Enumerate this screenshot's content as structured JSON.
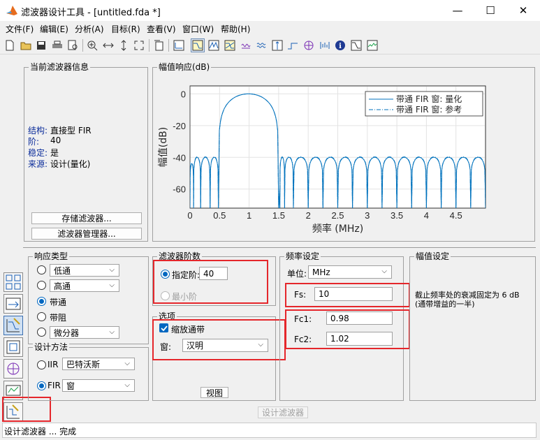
{
  "window": {
    "title": "滤波器设计工具 - [untitled.fda *]"
  },
  "menu": [
    "文件(F)",
    "编辑(E)",
    "分析(A)",
    "目标(R)",
    "查看(V)",
    "窗口(W)",
    "帮助(H)"
  ],
  "current_filter": {
    "title": "当前滤波器信息",
    "rows": [
      {
        "label": "结构:",
        "value": "直接型 FIR"
      },
      {
        "label": "阶:",
        "value": "40"
      },
      {
        "label": "稳定:",
        "value": "是"
      },
      {
        "label": "来源:",
        "value": "设计(量化)"
      }
    ],
    "store_button": "存储滤波器...",
    "manager_button": "滤波器管理器..."
  },
  "plot": {
    "panel_title": "幅值响应(dB)",
    "legend": [
      "带通 FIR 窗: 量化",
      "带通 FIR 窗: 参考"
    ]
  },
  "chart_data": {
    "type": "line",
    "xlabel": "频率 (MHz)",
    "ylabel": "幅值(dB)",
    "xlim": [
      0,
      5
    ],
    "ylim": [
      -72,
      5
    ],
    "xticks": [
      "0",
      "0.5",
      "1",
      "1.5",
      "2",
      "2.5",
      "3",
      "3.5",
      "4",
      "4.5"
    ],
    "yticks": [
      "0",
      "-20",
      "-40",
      "-60"
    ],
    "grid": true,
    "legend_position": "top-right",
    "series": [
      {
        "name": "带通 FIR 窗: 量化",
        "mainlobe": {
          "center": 1.0,
          "edges": [
            0.55,
            1.5
          ],
          "peak": 0
        },
        "sidelobe_level": -40,
        "sidelobe_nulls": [
          0.06,
          0.18,
          0.34,
          0.48,
          1.6,
          1.75,
          2.0,
          2.25,
          2.5,
          2.75,
          3.0,
          3.25,
          3.5,
          3.75,
          4.0,
          4.25,
          4.5,
          4.75,
          5.0
        ]
      },
      {
        "name": "带通 FIR 窗: 参考",
        "mainlobe": {
          "center": 1.0,
          "edges": [
            0.55,
            1.5
          ],
          "peak": 0
        },
        "sidelobe_level": -40,
        "sidelobe_nulls": [
          0.06,
          0.18,
          0.34,
          0.48,
          1.6,
          1.75,
          2.0,
          2.25,
          2.5,
          2.75,
          3.0,
          3.25,
          3.5,
          3.75,
          4.0,
          4.25,
          4.5,
          4.75,
          5.0
        ]
      }
    ]
  },
  "response_type": {
    "title": "响应类型",
    "options": [
      {
        "label": "低通",
        "type": "combo",
        "selected": false
      },
      {
        "label": "高通",
        "type": "combo",
        "selected": false
      },
      {
        "label": "带通",
        "type": "plain",
        "selected": true
      },
      {
        "label": "带阻",
        "type": "plain",
        "selected": false
      },
      {
        "label": "微分器",
        "type": "combo",
        "selected": false
      }
    ]
  },
  "design_method": {
    "title": "设计方法",
    "iir_label": "IIR",
    "iir_value": "巴特沃斯",
    "fir_label": "FIR",
    "fir_value": "窗",
    "selected": "FIR"
  },
  "filter_order": {
    "title": "滤波器阶数",
    "specify_label": "指定阶:",
    "specify_value": "40",
    "minimum_label": "最小阶"
  },
  "options": {
    "title": "选项",
    "scale_label": "缩放通带",
    "scale_checked": true,
    "window_label": "窗:",
    "window_value": "汉明",
    "view_button": "视图"
  },
  "freq_spec": {
    "title": "频率设定",
    "units_label": "单位:",
    "units_value": "MHz",
    "fs_label": "Fs:",
    "fs_value": "10",
    "fc1_label": "Fc1:",
    "fc1_value": "0.98",
    "fc2_label": "Fc2:",
    "fc2_value": "1.02"
  },
  "mag_spec": {
    "title": "幅值设定",
    "note": "截止频率处的衰减固定为 6 dB (通带增益的一半)"
  },
  "design_button": "设计滤波器",
  "status": "设计滤波器 ... 完成",
  "colors": {
    "accent": "#0067c0",
    "plot_line": "#0072bd",
    "highlight": "#e5262b"
  }
}
